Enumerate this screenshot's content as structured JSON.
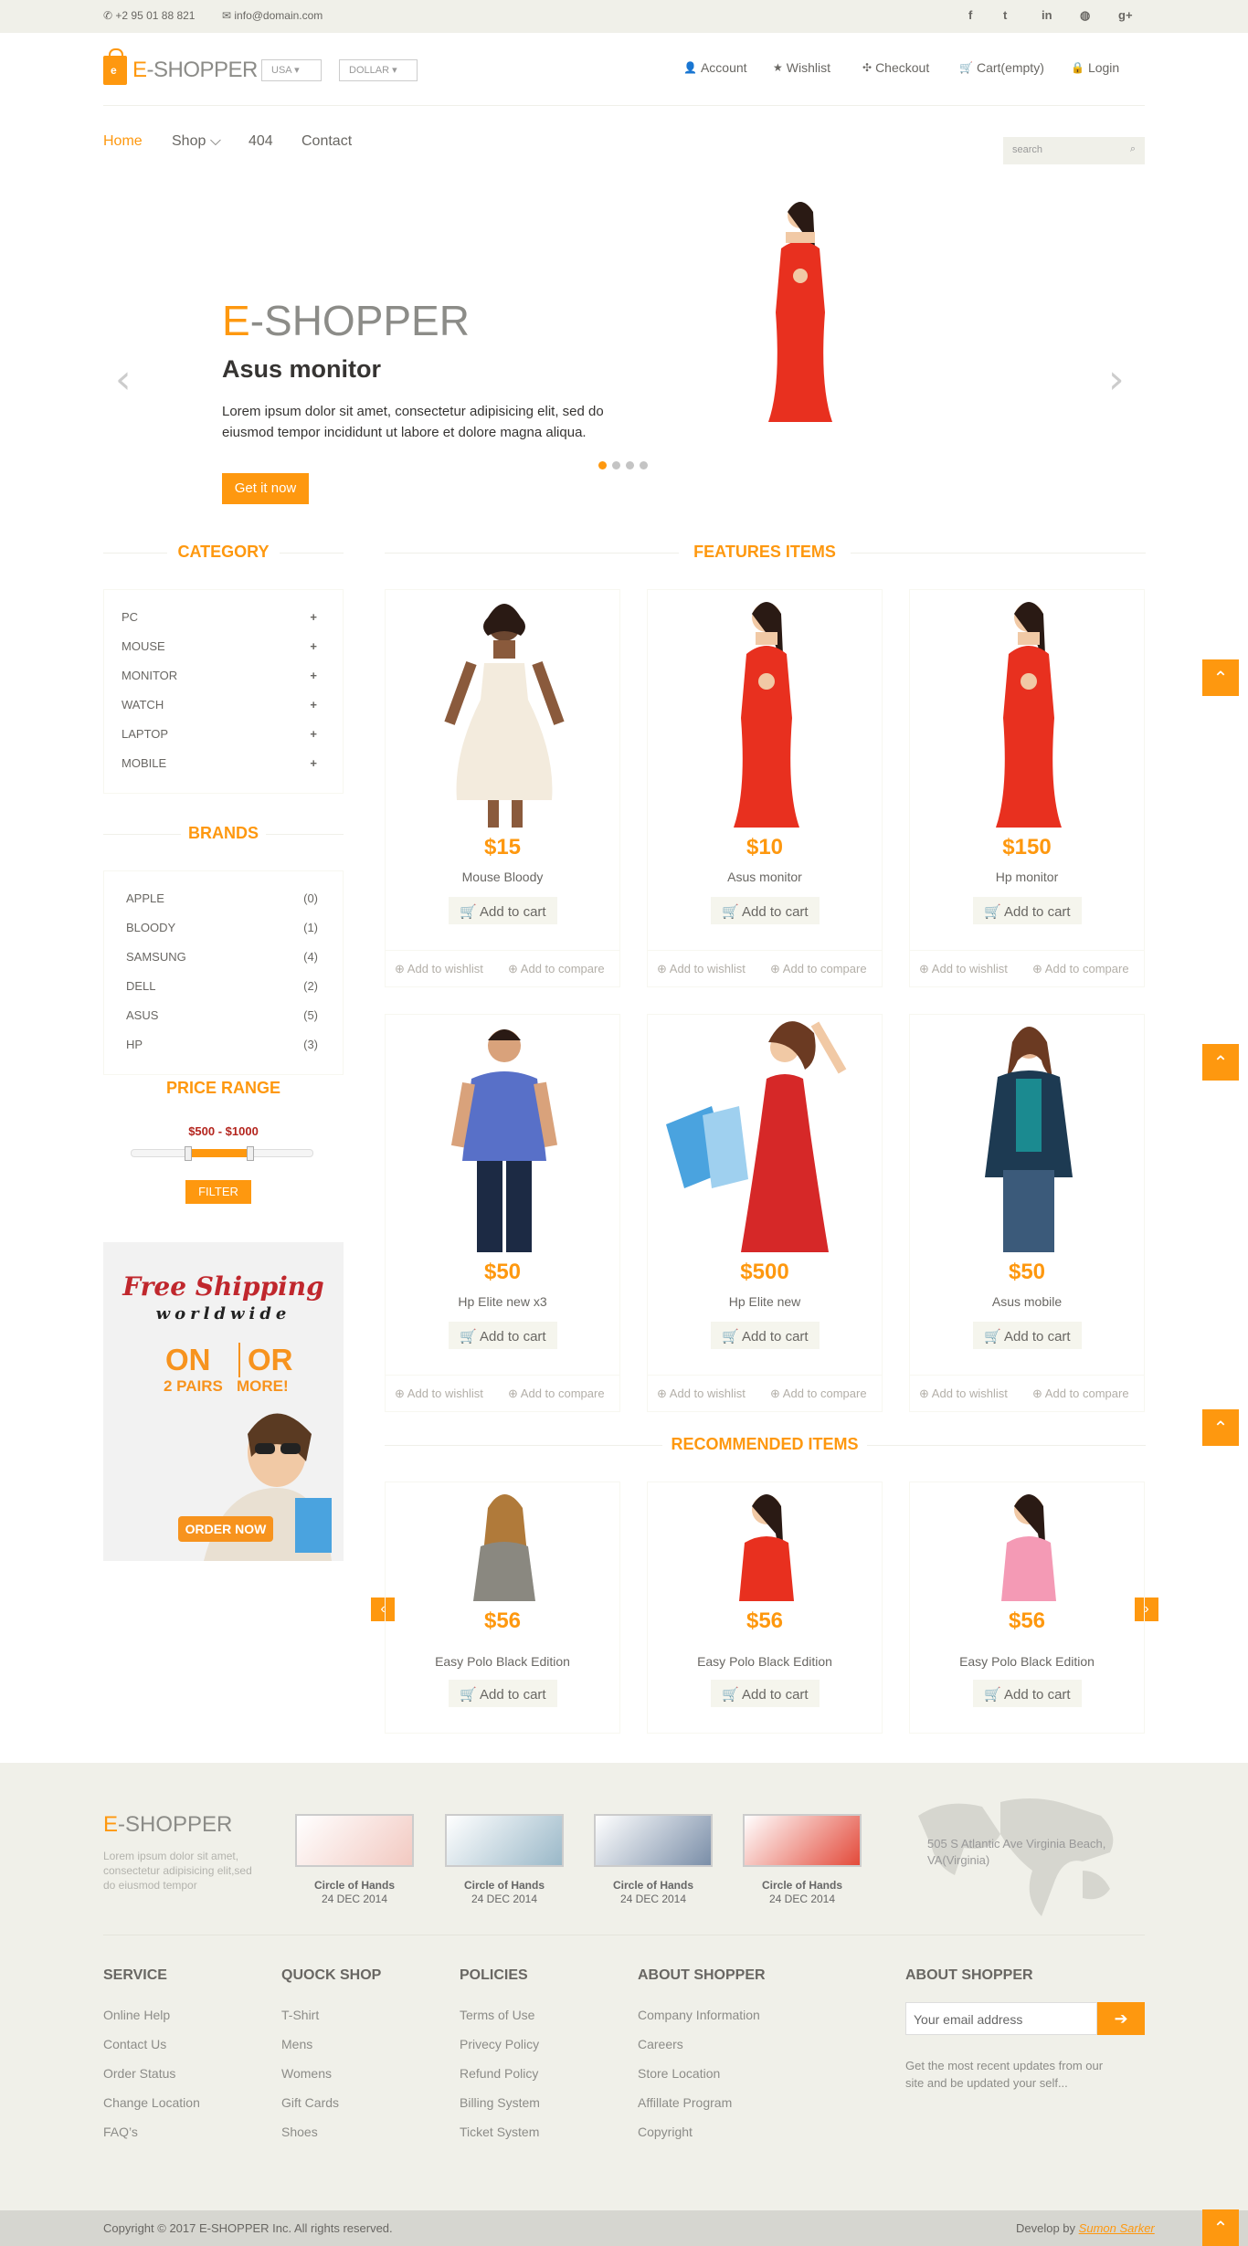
{
  "topbar": {
    "phone": "+2 95 01 88 821",
    "email": "info@domain.com",
    "social": [
      "f",
      "t",
      "in",
      "◍",
      "g+"
    ]
  },
  "header": {
    "brand_e": "E",
    "brand_rest": "-SHOPPER",
    "country": "USA ▾",
    "currency": "DOLLAR ▾",
    "account_links": [
      "Account",
      "Wishlist",
      "Checkout",
      "Cart(empty)",
      "Login"
    ]
  },
  "nav": {
    "items": [
      "Home",
      "Shop ⌵",
      "404",
      "Contact"
    ],
    "search_placeholder": "search"
  },
  "slider": {
    "brand_e": "E",
    "brand_rest": "-SHOPPER",
    "title": "Asus monitor",
    "description": "Lorem ipsum dolor sit amet, consectetur adipisicing elit, sed do eiusmod tempor incididunt ut labore et dolore magna aliqua.",
    "button": "Get it now",
    "prev": "‹",
    "next": "›",
    "slide_count": 4,
    "active_slide": 1
  },
  "sidebar": {
    "category_title": "CATEGORY",
    "categories": [
      "PC",
      "MOUSE",
      "MONITOR",
      "WATCH",
      "LAPTOP",
      "MOBILE"
    ],
    "brands_title": "BRANDS",
    "brands": [
      {
        "name": "APPLE",
        "count": "(0)"
      },
      {
        "name": "BLOODY",
        "count": "(1)"
      },
      {
        "name": "SAMSUNG",
        "count": "(4)"
      },
      {
        "name": "DELL",
        "count": "(2)"
      },
      {
        "name": "ASUS",
        "count": "(5)"
      },
      {
        "name": "HP",
        "count": "(3)"
      }
    ],
    "price_title": "PRICE RANGE",
    "price_range": "$500 - $1000",
    "filter_button": "FILTER",
    "promo": {
      "line1": "Free Shipping",
      "line2": "worldwide",
      "on": "ON",
      "or": "OR",
      "pairs": "2 PAIRS",
      "more": "MORE!",
      "order": "ORDER NOW"
    }
  },
  "features": {
    "title": "FEATURES ITEMS",
    "add_to_cart": "Add to cart",
    "wishlist": "Add to wishlist",
    "compare": "Add to compare",
    "products": [
      {
        "price": "$15",
        "name": "Mouse Bloody",
        "figure": "white-dress"
      },
      {
        "price": "$10",
        "name": "Asus monitor",
        "figure": "red-dress"
      },
      {
        "price": "$150",
        "name": "Hp monitor",
        "figure": "red-dress"
      },
      {
        "price": "$50",
        "name": "Hp Elite new x3",
        "figure": "blue-shirt-man"
      },
      {
        "price": "$500",
        "name": "Hp Elite new",
        "figure": "red-dress-bags"
      },
      {
        "price": "$50",
        "name": "Asus mobile",
        "figure": "teal-top"
      }
    ]
  },
  "recommended": {
    "title": "RECOMMENDED ITEMS",
    "add_to_cart": "Add to cart",
    "products": [
      {
        "price": "$56",
        "name": "Easy Polo Black Edition"
      },
      {
        "price": "$56",
        "name": "Easy Polo Black Edition"
      },
      {
        "price": "$56",
        "name": "Easy Polo Black Edition"
      }
    ]
  },
  "footer": {
    "brand_e": "E",
    "brand_rest": "-SHOPPER",
    "tagline": "Lorem ipsum dolor sit amet, consectetur adipisicing elit,sed do eiusmod tempor",
    "videos": [
      {
        "caption": "Circle of Hands",
        "date": "24 DEC 2014"
      },
      {
        "caption": "Circle of Hands",
        "date": "24 DEC 2014"
      },
      {
        "caption": "Circle of Hands",
        "date": "24 DEC 2014"
      },
      {
        "caption": "Circle of Hands",
        "date": "24 DEC 2014"
      }
    ],
    "address": "505 S Atlantic Ave Virginia Beach, VA(Virginia)",
    "columns": [
      {
        "title": "SERVICE",
        "links": [
          "Online Help",
          "Contact Us",
          "Order Status",
          "Change Location",
          "FAQ’s"
        ]
      },
      {
        "title": "QUOCK SHOP",
        "links": [
          "T-Shirt",
          "Mens",
          "Womens",
          "Gift Cards",
          "Shoes"
        ]
      },
      {
        "title": "POLICIES",
        "links": [
          "Terms of Use",
          "Privecy Policy",
          "Refund Policy",
          "Billing System",
          "Ticket System"
        ]
      },
      {
        "title": "ABOUT SHOPPER",
        "links": [
          "Company Information",
          "Careers",
          "Store Location",
          "Affillate Program",
          "Copyright"
        ]
      }
    ],
    "subscribe_title": "ABOUT SHOPPER",
    "subscribe_placeholder": "Your email address",
    "subscribe_note": "Get the most recent updates from our site and be updated your self...",
    "copyright": "Copyright © 2017 E-SHOPPER Inc. All rights reserved.",
    "develop_by": "Develop by",
    "developer": "Sumon Sarker"
  },
  "scroll_up": "⌃",
  "colors": {
    "accent": "#fe980f",
    "bg_light": "#f0f0e9",
    "text": "#696763"
  }
}
